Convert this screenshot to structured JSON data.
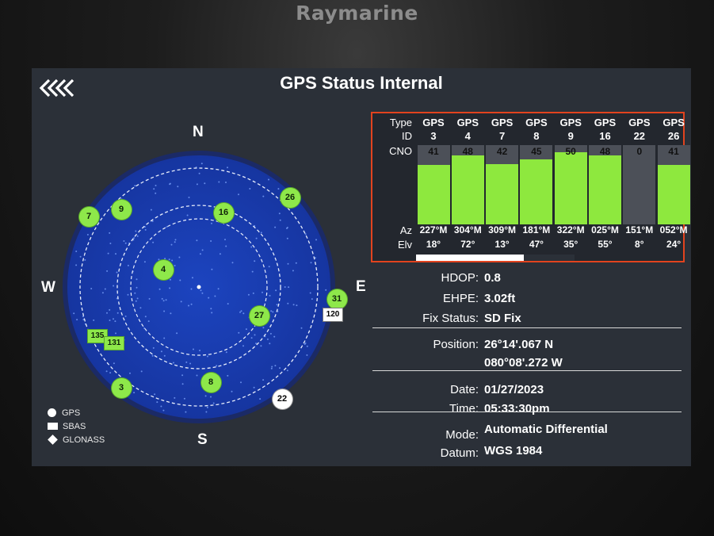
{
  "device": {
    "brand": "Raymarine"
  },
  "page": {
    "title": "GPS Status Internal"
  },
  "compass": {
    "north": "N",
    "south": "S",
    "east": "E",
    "west": "W"
  },
  "sky_satellites": [
    {
      "id": "7",
      "kind": "GPS"
    },
    {
      "id": "9",
      "kind": "GPS"
    },
    {
      "id": "16",
      "kind": "GPS"
    },
    {
      "id": "26",
      "kind": "GPS"
    },
    {
      "id": "4",
      "kind": "GPS"
    },
    {
      "id": "31",
      "kind": "GPS"
    },
    {
      "id": "120",
      "kind": "SBAS",
      "tracked": false
    },
    {
      "id": "27",
      "kind": "GPS"
    },
    {
      "id": "135",
      "kind": "SBAS"
    },
    {
      "id": "131",
      "kind": "SBAS"
    },
    {
      "id": "3",
      "kind": "GPS"
    },
    {
      "id": "8",
      "kind": "GPS"
    },
    {
      "id": "22",
      "kind": "GPS",
      "tracked": false
    }
  ],
  "legend": {
    "gps": "GPS",
    "sbas": "SBAS",
    "glonass": "GLONASS"
  },
  "signal_table": {
    "labels": {
      "type": "Type",
      "id": "ID",
      "cno": "CNO",
      "az": "Az",
      "elv": "Elv"
    },
    "satellites": [
      {
        "type": "GPS",
        "id": "3",
        "cno": "41",
        "az": "227°M",
        "elv": "18°"
      },
      {
        "type": "GPS",
        "id": "4",
        "cno": "48",
        "az": "304°M",
        "elv": "72°"
      },
      {
        "type": "GPS",
        "id": "7",
        "cno": "42",
        "az": "309°M",
        "elv": "13°"
      },
      {
        "type": "GPS",
        "id": "8",
        "cno": "45",
        "az": "181°M",
        "elv": "47°"
      },
      {
        "type": "GPS",
        "id": "9",
        "cno": "50",
        "az": "322°M",
        "elv": "35°"
      },
      {
        "type": "GPS",
        "id": "16",
        "cno": "48",
        "az": "025°M",
        "elv": "55°"
      },
      {
        "type": "GPS",
        "id": "22",
        "cno": "0",
        "az": "151°M",
        "elv": "8°"
      },
      {
        "type": "GPS",
        "id": "26",
        "cno": "41",
        "az": "052°M",
        "elv": "24°"
      }
    ],
    "cno_max": 55,
    "scroll_fraction": 0.68
  },
  "status": {
    "hdop_label": "HDOP:",
    "hdop": "0.8",
    "ehpe_label": "EHPE:",
    "ehpe": "3.02ft",
    "fix_label": "Fix Status:",
    "fix": "SD Fix",
    "position_label": "Position:",
    "lat": "26°14'.067 N",
    "lon": "080°08'.272 W",
    "date_label": "Date:",
    "date": "01/27/2023",
    "time_label": "Time:",
    "time": "05:33:30pm",
    "mode_label": "Mode:",
    "mode": "Automatic Differential",
    "datum_label": "Datum:",
    "datum": "WGS 1984"
  },
  "colors": {
    "sky": "#1c3fb0",
    "satellite": "#8ee84a",
    "panel_border": "#e2431e"
  }
}
